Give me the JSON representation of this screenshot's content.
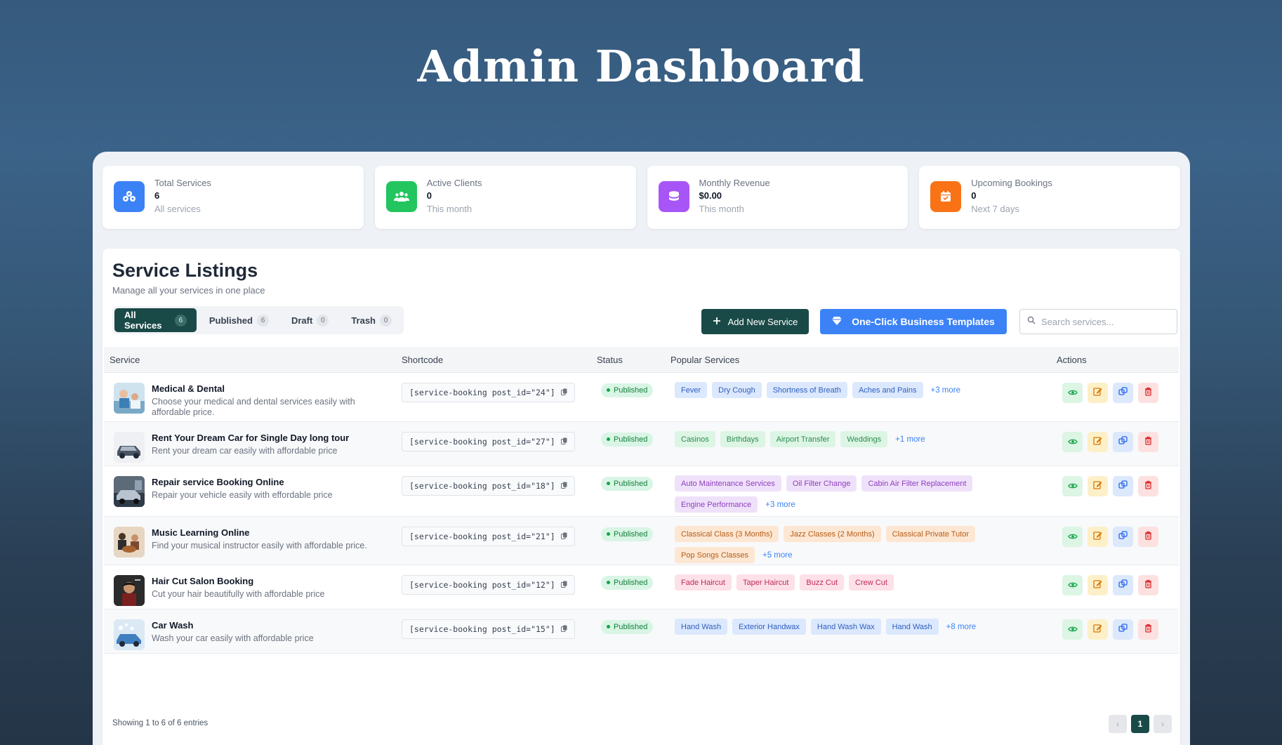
{
  "page_title": "Admin Dashboard",
  "stats": [
    {
      "label": "Total Services",
      "value": "6",
      "sub": "All services",
      "icon": "services-icon",
      "color": "#3b82f6"
    },
    {
      "label": "Active Clients",
      "value": "0",
      "sub": "This month",
      "icon": "users-icon",
      "color": "#22c55e"
    },
    {
      "label": "Monthly Revenue",
      "value": "$0.00",
      "sub": "This month",
      "icon": "coins-icon",
      "color": "#a855f7"
    },
    {
      "label": "Upcoming Bookings",
      "value": "0",
      "sub": "Next 7 days",
      "icon": "calendar-icon",
      "color": "#f97316"
    }
  ],
  "listings": {
    "title": "Service Listings",
    "subtitle": "Manage all your services in one place",
    "tabs": [
      {
        "label": "All Services",
        "count": "6",
        "active": true
      },
      {
        "label": "Published",
        "count": "6",
        "active": false
      },
      {
        "label": "Draft",
        "count": "0",
        "active": false
      },
      {
        "label": "Trash",
        "count": "0",
        "active": false
      }
    ],
    "add_button": "Add New Service",
    "templates_button": "One-Click Business Templates",
    "search_placeholder": "Search services...",
    "columns": [
      "Service",
      "Shortcode",
      "Status",
      "Popular Services",
      "Actions"
    ],
    "rows": [
      {
        "name": "Medical & Dental",
        "desc": "Choose your medical and dental services easily with affordable price.",
        "shortcode": "[service-booking post_id=\"24\"]",
        "status": "Published",
        "tag_color": "blue",
        "tags": [
          "Fever",
          "Dry Cough",
          "Shortness of Breath",
          "Aches and Pains"
        ],
        "more": "+3 more",
        "height": 70,
        "thumb": "medical"
      },
      {
        "name": "Rent Your Dream Car for Single Day long tour",
        "desc": "Rent your dream car easily with affordable price",
        "shortcode": "[service-booking post_id=\"27\"]",
        "status": "Published",
        "tag_color": "green",
        "tags": [
          "Casinos",
          "Birthdays",
          "Airport Transfer",
          "Weddings"
        ],
        "more": "+1 more",
        "height": 63,
        "thumb": "car"
      },
      {
        "name": "Repair service Booking Online",
        "desc": "Repair your vehicle easily with effordable price",
        "shortcode": "[service-booking post_id=\"18\"]",
        "status": "Published",
        "tag_color": "purple",
        "tags": [
          "Auto Maintenance Services",
          "Oil Filter Change",
          "Cabin Air Filter Replacement",
          "Engine Performance"
        ],
        "more": "+3 more",
        "height": 72,
        "thumb": "repair"
      },
      {
        "name": "Music Learning Online",
        "desc": "Find your musical instructor easily with affordable price.",
        "shortcode": "[service-booking post_id=\"21\"]",
        "status": "Published",
        "tag_color": "orange",
        "tags": [
          "Classical Class (3 Months)",
          "Jazz Classes (2 Months)",
          "Classical Private Tutor",
          "Pop Songs Classes"
        ],
        "more": "+5 more",
        "height": 69,
        "thumb": "music"
      },
      {
        "name": "Hair Cut Salon Booking",
        "desc": "Cut your hair beautifully with affordable price",
        "shortcode": "[service-booking post_id=\"12\"]",
        "status": "Published",
        "tag_color": "pink",
        "tags": [
          "Fade Haircut",
          "Taper Haircut",
          "Buzz Cut",
          "Crew Cut"
        ],
        "more": "",
        "height": 63,
        "thumb": "hair"
      },
      {
        "name": "Car Wash",
        "desc": "Wash your car easily with affordable price",
        "shortcode": "[service-booking post_id=\"15\"]",
        "status": "Published",
        "tag_color": "blue",
        "tags": [
          "Hand Wash",
          "Exterior Handwax",
          "Hand Wash Wax",
          "Hand Wash"
        ],
        "more": "+8 more",
        "height": 63,
        "thumb": "wash"
      }
    ],
    "footer": "Showing 1 to 6 of 6 entries",
    "pagination": {
      "prev": "‹",
      "current": "1",
      "next": "›"
    }
  }
}
